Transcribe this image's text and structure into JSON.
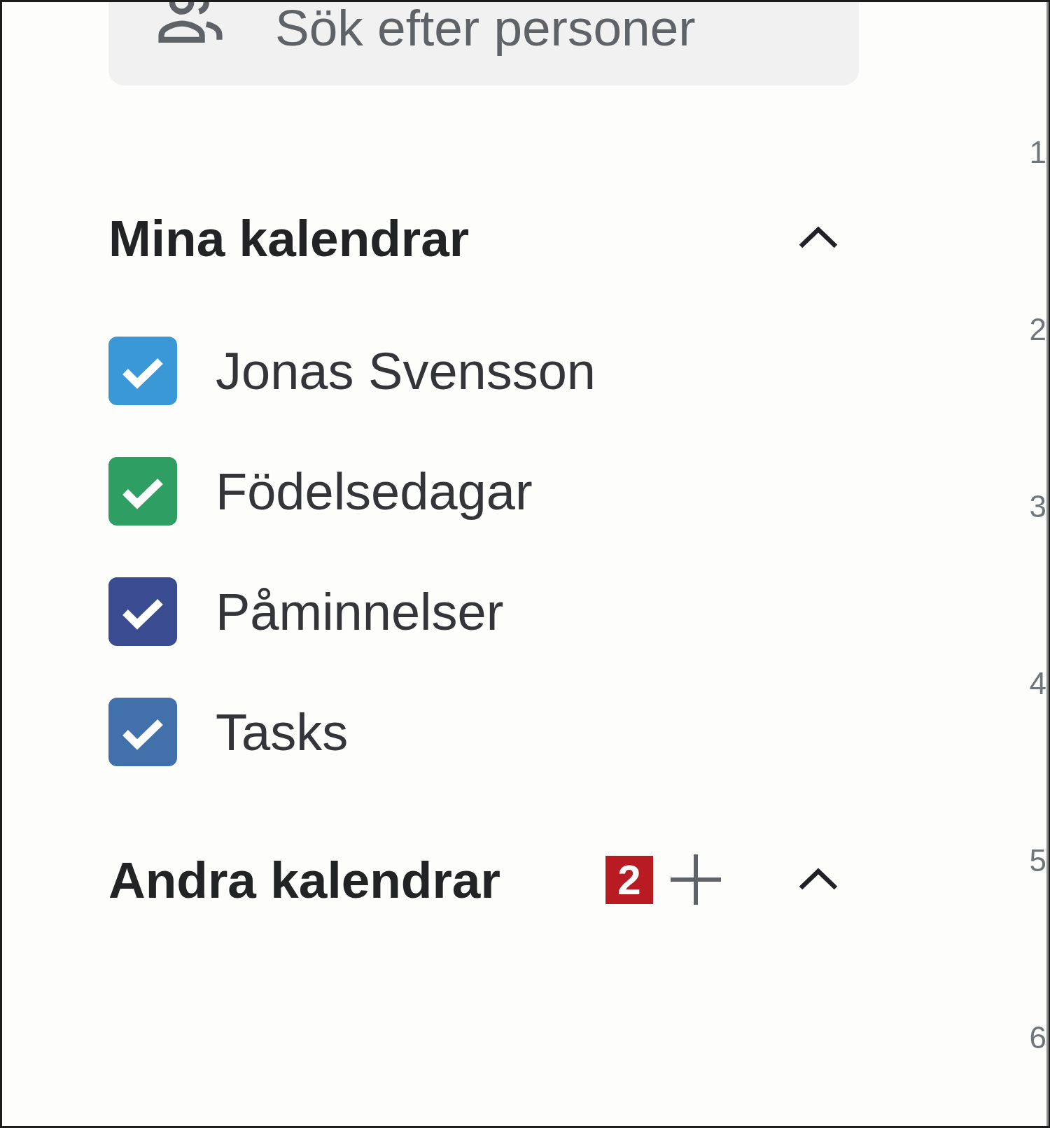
{
  "search": {
    "placeholder": "Sök efter personer"
  },
  "my_calendars": {
    "title": "Mina kalendrar",
    "expanded": true,
    "items": [
      {
        "label": "Jonas Svensson",
        "checked": true,
        "color": "#3b98d6"
      },
      {
        "label": "Födelsedagar",
        "checked": true,
        "color": "#2e9e63"
      },
      {
        "label": "Påminnelser",
        "checked": true,
        "color": "#3b4b8f"
      },
      {
        "label": "Tasks",
        "checked": true,
        "color": "#4270ab"
      }
    ]
  },
  "other_calendars": {
    "title": "Andra kalendrar",
    "expanded": true,
    "callout": "2"
  },
  "hour_labels": [
    "1",
    "2",
    "3",
    "4",
    "5",
    "6"
  ]
}
